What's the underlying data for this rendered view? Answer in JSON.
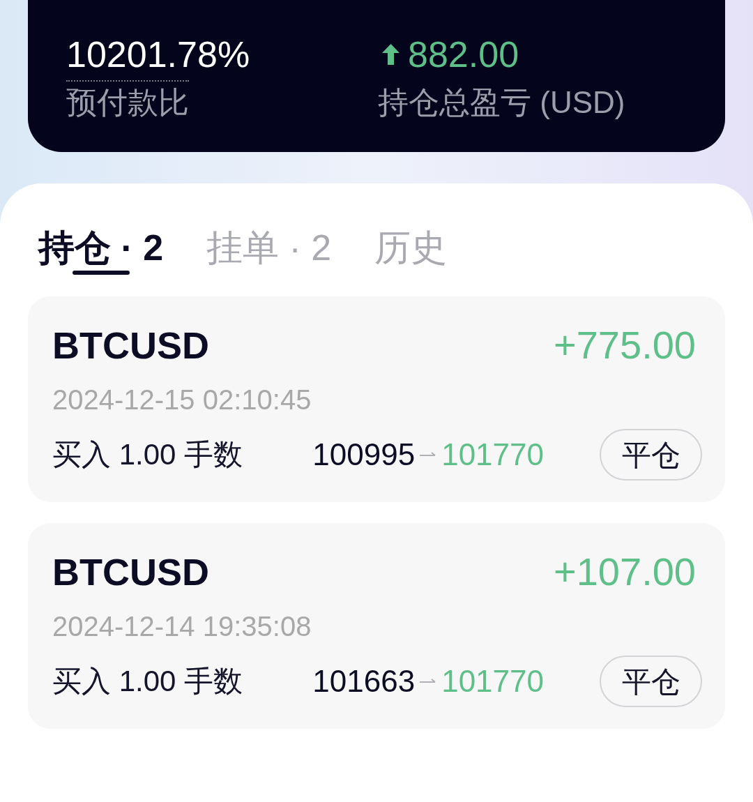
{
  "summary": {
    "stats": [
      {
        "kind": "ratio",
        "value": "10201.78%",
        "label": "预付款比"
      },
      {
        "kind": "pnl",
        "rising": true,
        "value": "882.00",
        "label": "持仓总盈亏 (USD)"
      }
    ]
  },
  "tabs": [
    {
      "label": "持仓 · 2",
      "selected": true
    },
    {
      "label": "挂单 · 2",
      "selected": false
    },
    {
      "label": "历史",
      "selected": false
    }
  ],
  "positions": [
    {
      "symbol": "BTCUSD",
      "rising": true,
      "pnl": "+775.00",
      "time": "2024-12-15 02:10:45",
      "order": "买入 1.00 手数",
      "open_price": "100995",
      "current_price": "101770",
      "action": "平仓"
    },
    {
      "symbol": "BTCUSD",
      "rising": true,
      "pnl": "+107.00",
      "time": "2024-12-14 19:35:08",
      "order": "买入 1.00 手数",
      "open_price": "101663",
      "current_price": "101770",
      "action": "平仓"
    }
  ]
}
